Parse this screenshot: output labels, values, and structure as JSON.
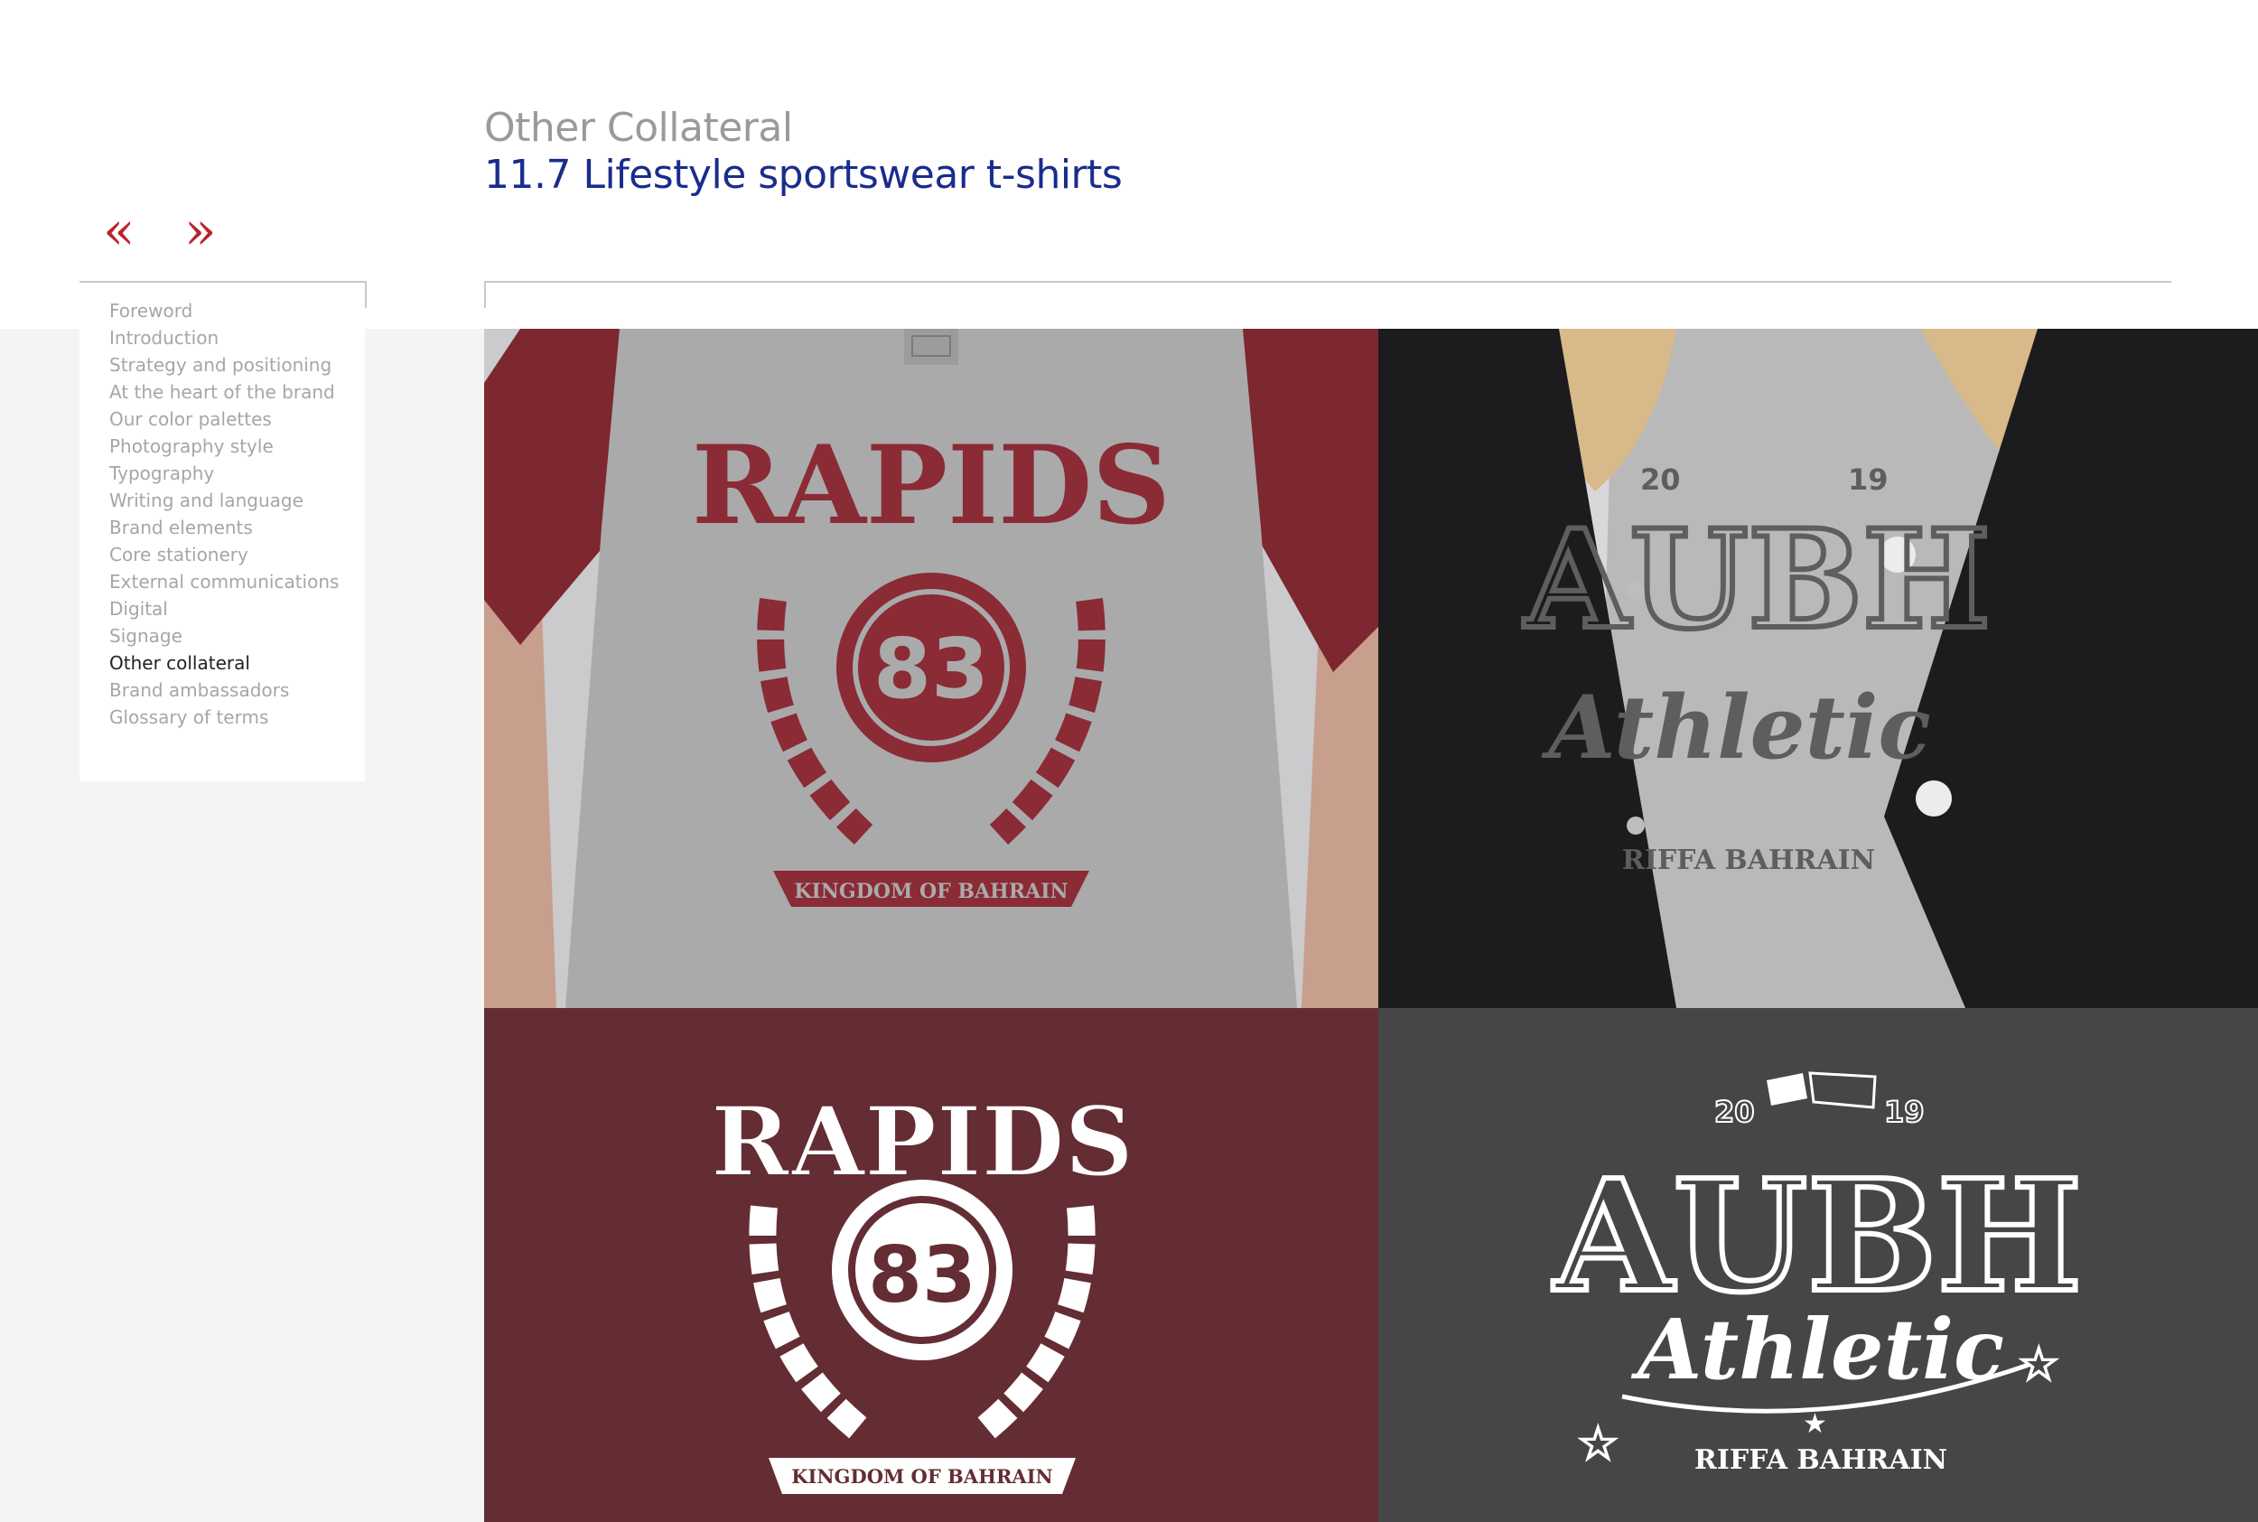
{
  "header": {
    "section_title": "Other Collateral",
    "page_title": "11.7 Lifestyle sportswear t-shirts"
  },
  "nav": {
    "prev_label": "«",
    "next_label": "»"
  },
  "sidebar": {
    "items": [
      {
        "label": "Foreword",
        "active": false
      },
      {
        "label": "Introduction",
        "active": false
      },
      {
        "label": "Strategy and positioning",
        "active": false
      },
      {
        "label": "At the heart of the brand",
        "active": false
      },
      {
        "label": "Our color palettes",
        "active": false
      },
      {
        "label": "Photography style",
        "active": false
      },
      {
        "label": "Typography",
        "active": false
      },
      {
        "label": "Writing and language",
        "active": false
      },
      {
        "label": "Brand elements",
        "active": false
      },
      {
        "label": "Core stationery",
        "active": false
      },
      {
        "label": "External communications",
        "active": false
      },
      {
        "label": "Digital",
        "active": false
      },
      {
        "label": "Signage",
        "active": false
      },
      {
        "label": "Other collateral",
        "active": true
      },
      {
        "label": "Brand ambassadors",
        "active": false
      },
      {
        "label": "Glossary of terms",
        "active": false
      }
    ]
  },
  "designs": {
    "rapids": {
      "title": "RAPIDS",
      "number": "83",
      "banner": "KINGDOM OF BAHRAIN"
    },
    "aubh": {
      "year_left": "20",
      "year_right": "19",
      "title": "AUBH",
      "script": "Athletic",
      "location": "RIFFA BAHRAIN"
    }
  },
  "colors": {
    "accent_red": "#b8242c",
    "title_blue": "#1a2c8c",
    "maroon": "#642d33",
    "charcoal": "#464648",
    "shirt_gray": "#a9a9a9"
  }
}
